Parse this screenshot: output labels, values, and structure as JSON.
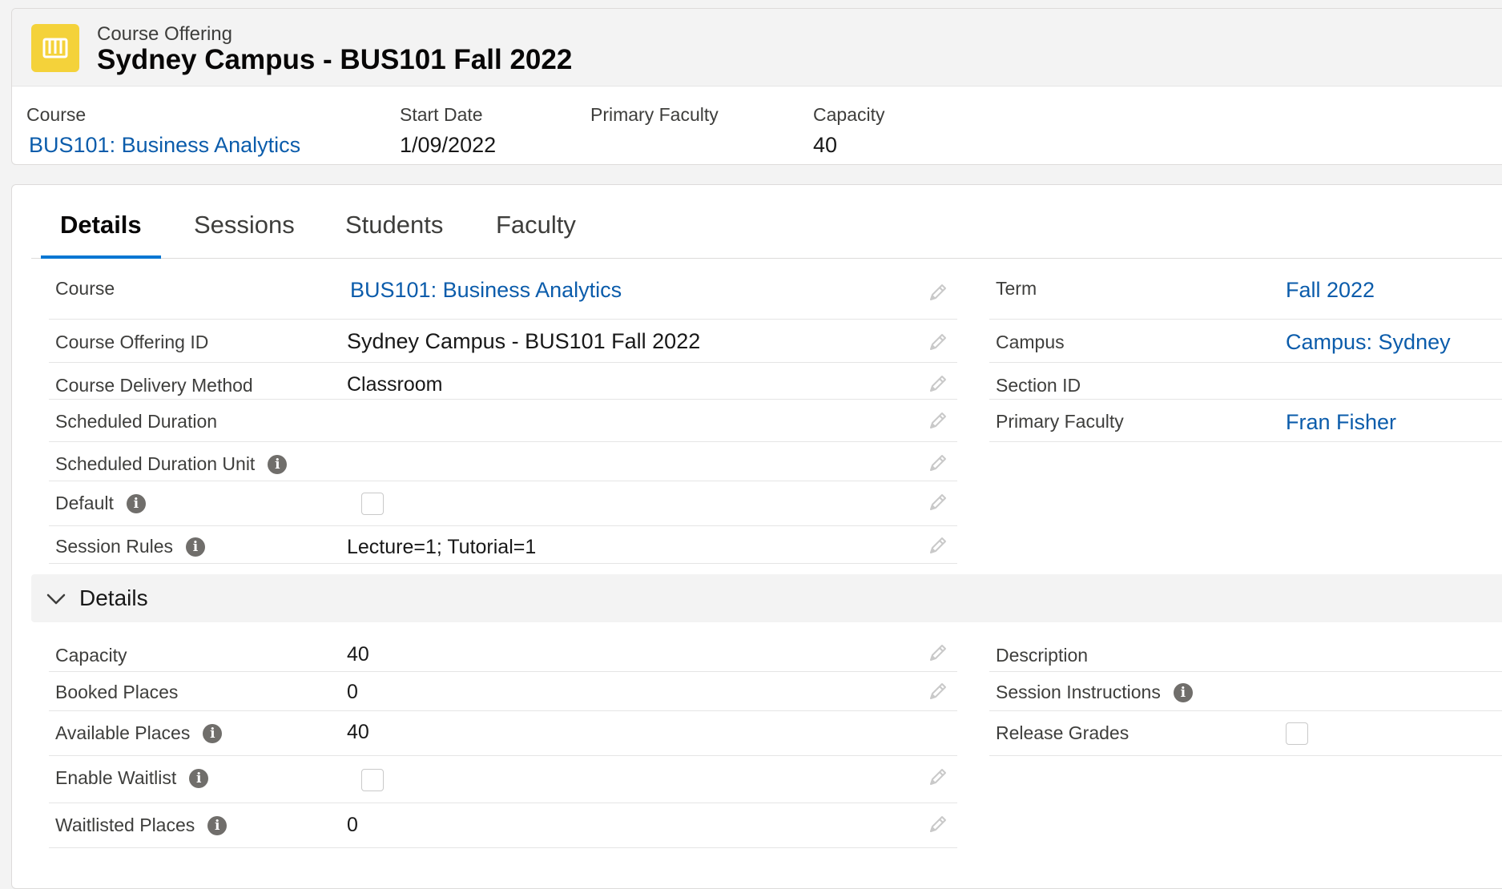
{
  "header": {
    "object_label": "Course Offering",
    "record_title": "Sydney Campus - BUS101 Fall 2022",
    "icon": "book-icon",
    "icon_color": "#f4d23a"
  },
  "highlights": {
    "course_label": "Course",
    "course_value": "BUS101: Business Analytics",
    "start_date_label": "Start Date",
    "start_date_value": "1/09/2022",
    "primary_faculty_label": "Primary Faculty",
    "primary_faculty_value": "",
    "capacity_label": "Capacity",
    "capacity_value": "40"
  },
  "tabs": [
    {
      "label": "Details",
      "active": true
    },
    {
      "label": "Sessions",
      "active": false
    },
    {
      "label": "Students",
      "active": false
    },
    {
      "label": "Faculty",
      "active": false
    }
  ],
  "details": {
    "left": [
      {
        "label": "Course",
        "value": "BUS101: Business Analytics",
        "link": true
      },
      {
        "label": "Course Offering ID",
        "value": "Sydney Campus - BUS101 Fall 2022"
      },
      {
        "label": "Course Delivery Method",
        "value": "Classroom"
      },
      {
        "label": "Scheduled Duration",
        "value": ""
      },
      {
        "label": "Scheduled Duration Unit",
        "value": "",
        "info": true
      },
      {
        "label": "Default",
        "value": "",
        "info": true,
        "checkbox": true,
        "checked": false
      },
      {
        "label": "Session Rules",
        "value": "Lecture=1; Tutorial=1",
        "info": true
      }
    ],
    "right": [
      {
        "label": "Term",
        "value": "Fall 2022",
        "link": true
      },
      {
        "label": "Campus",
        "value": "Campus: Sydney",
        "link": true
      },
      {
        "label": "Section ID",
        "value": ""
      },
      {
        "label": "Primary Faculty",
        "value": "Fran Fisher",
        "link": true
      }
    ]
  },
  "section": {
    "title": "Details",
    "expanded": true,
    "left": [
      {
        "label": "Capacity",
        "value": "40"
      },
      {
        "label": "Booked Places",
        "value": "0"
      },
      {
        "label": "Available Places",
        "value": "40",
        "info": true
      },
      {
        "label": "Enable Waitlist",
        "value": "",
        "info": true,
        "checkbox": true,
        "checked": false
      },
      {
        "label": "Waitlisted Places",
        "value": "0",
        "info": true
      }
    ],
    "right": [
      {
        "label": "Description",
        "value": ""
      },
      {
        "label": "Session Instructions",
        "value": "",
        "info": true
      },
      {
        "label": "Release Grades",
        "value": "",
        "checkbox": true,
        "checked": false
      }
    ]
  },
  "colors": {
    "link": "#0b5cab",
    "tab_active_underline": "#0176d3",
    "info_icon": "#706e6b"
  }
}
